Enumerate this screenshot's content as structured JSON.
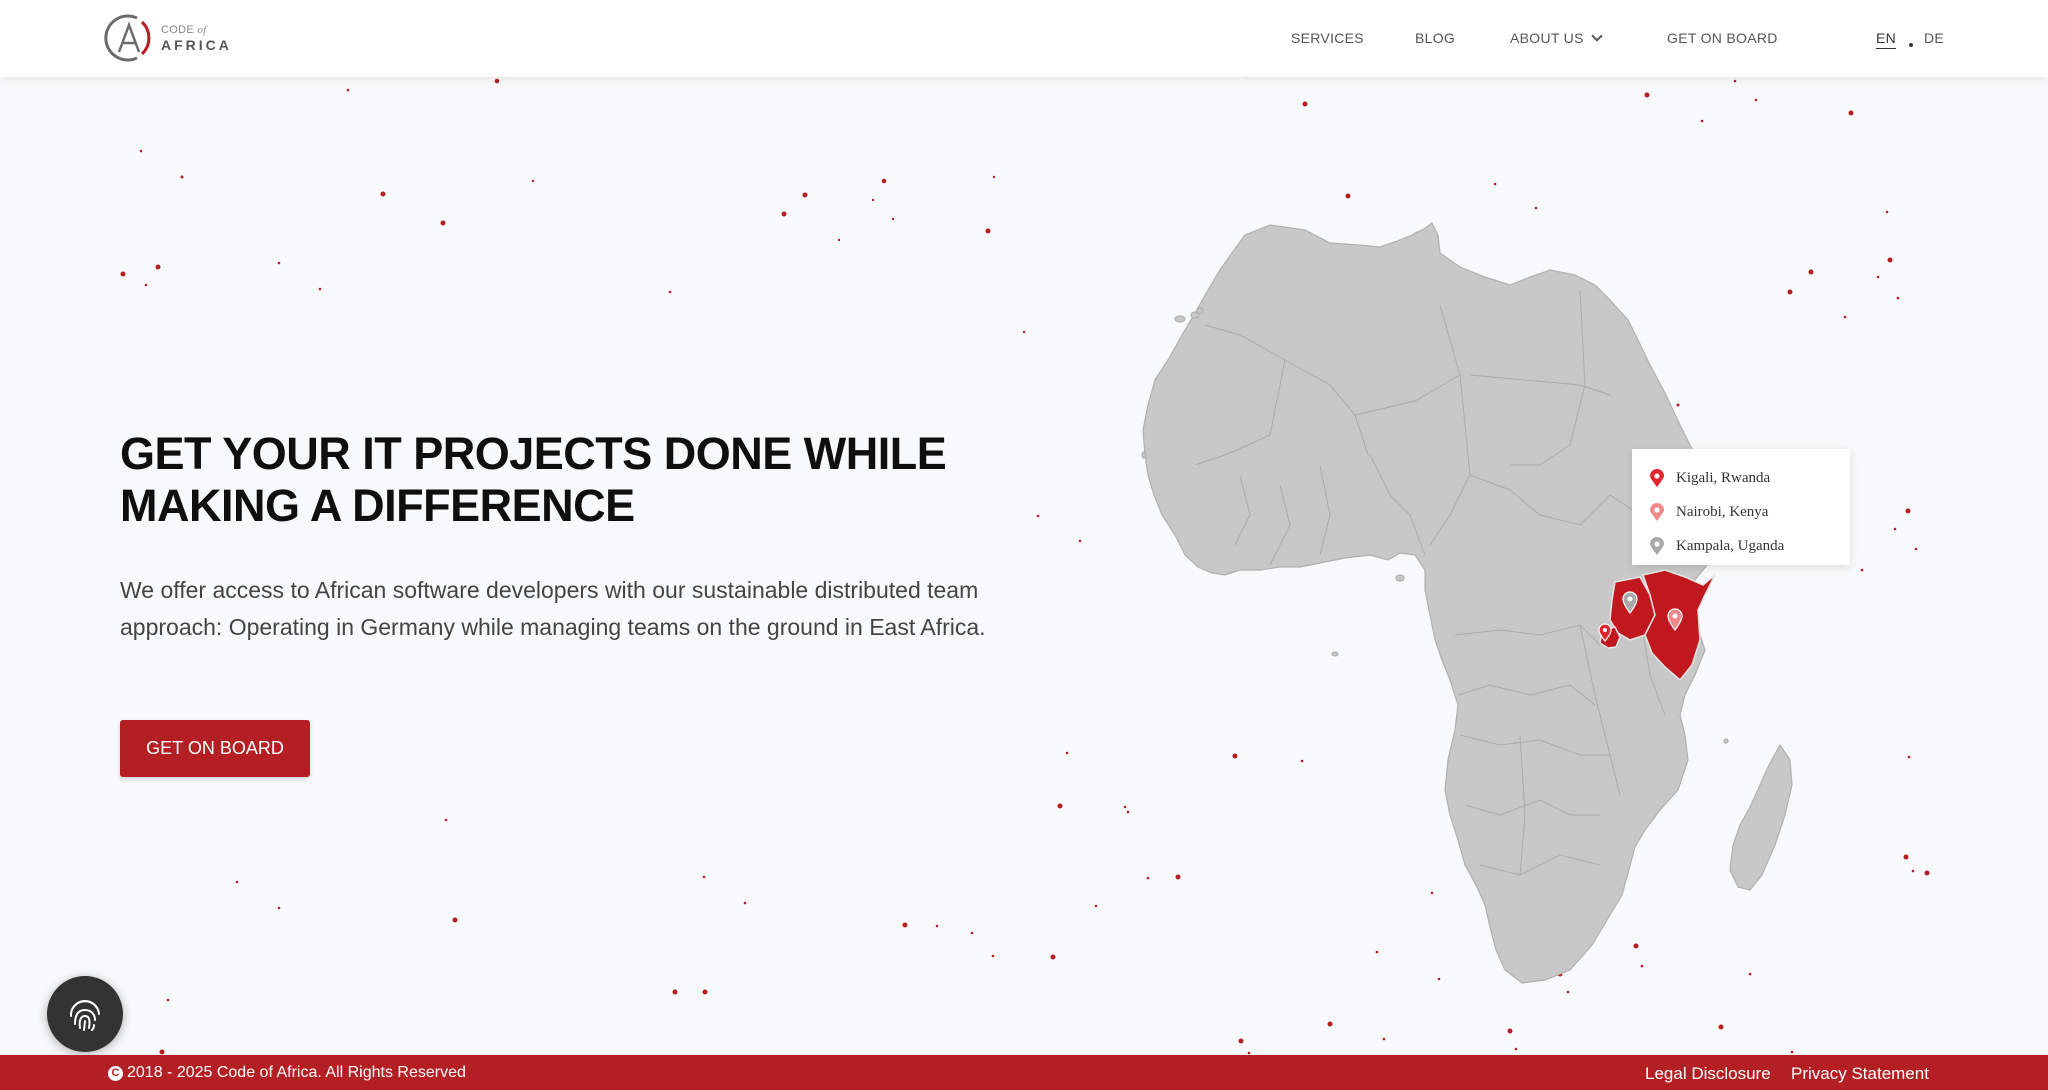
{
  "header": {
    "logo": {
      "code": "CODE",
      "of": "of",
      "africa": "AFRICA"
    },
    "nav": {
      "services": "SERVICES",
      "blog": "BLOG",
      "about": "ABOUT US",
      "get_on_board": "GET ON BOARD"
    },
    "lang": {
      "en": "EN",
      "de": "DE"
    }
  },
  "hero": {
    "title_line1": "GET YOUR IT PROJECTS DONE WHILE",
    "title_line2": "MAKING A DIFFERENCE",
    "text": "We offer access to African software developers with our sustainable distributed team approach: Operating in Germany while managing teams on the ground in East Africa.",
    "cta": "GET ON BOARD"
  },
  "map": {
    "locations": [
      {
        "label": "Kigali, Rwanda",
        "color": "#e0262c"
      },
      {
        "label": "Nairobi, Kenya",
        "color": "#f08a8a"
      },
      {
        "label": "Kampala, Uganda",
        "color": "#a9a9a9"
      }
    ],
    "land_color": "#c8c8c8",
    "highlight_color": "#c0181e"
  },
  "footer": {
    "copyright": "2018 - 2025 Code of Africa. All Rights Reserved",
    "legal": "Legal Disclosure",
    "privacy": "Privacy Statement"
  },
  "colors": {
    "brand": "#b41f24",
    "background": "#f8f9fa"
  },
  "icons": {
    "consent": "fingerprint-icon",
    "nav_dropdown": "chevron-down-icon",
    "map_pin": "map-pin-icon"
  }
}
